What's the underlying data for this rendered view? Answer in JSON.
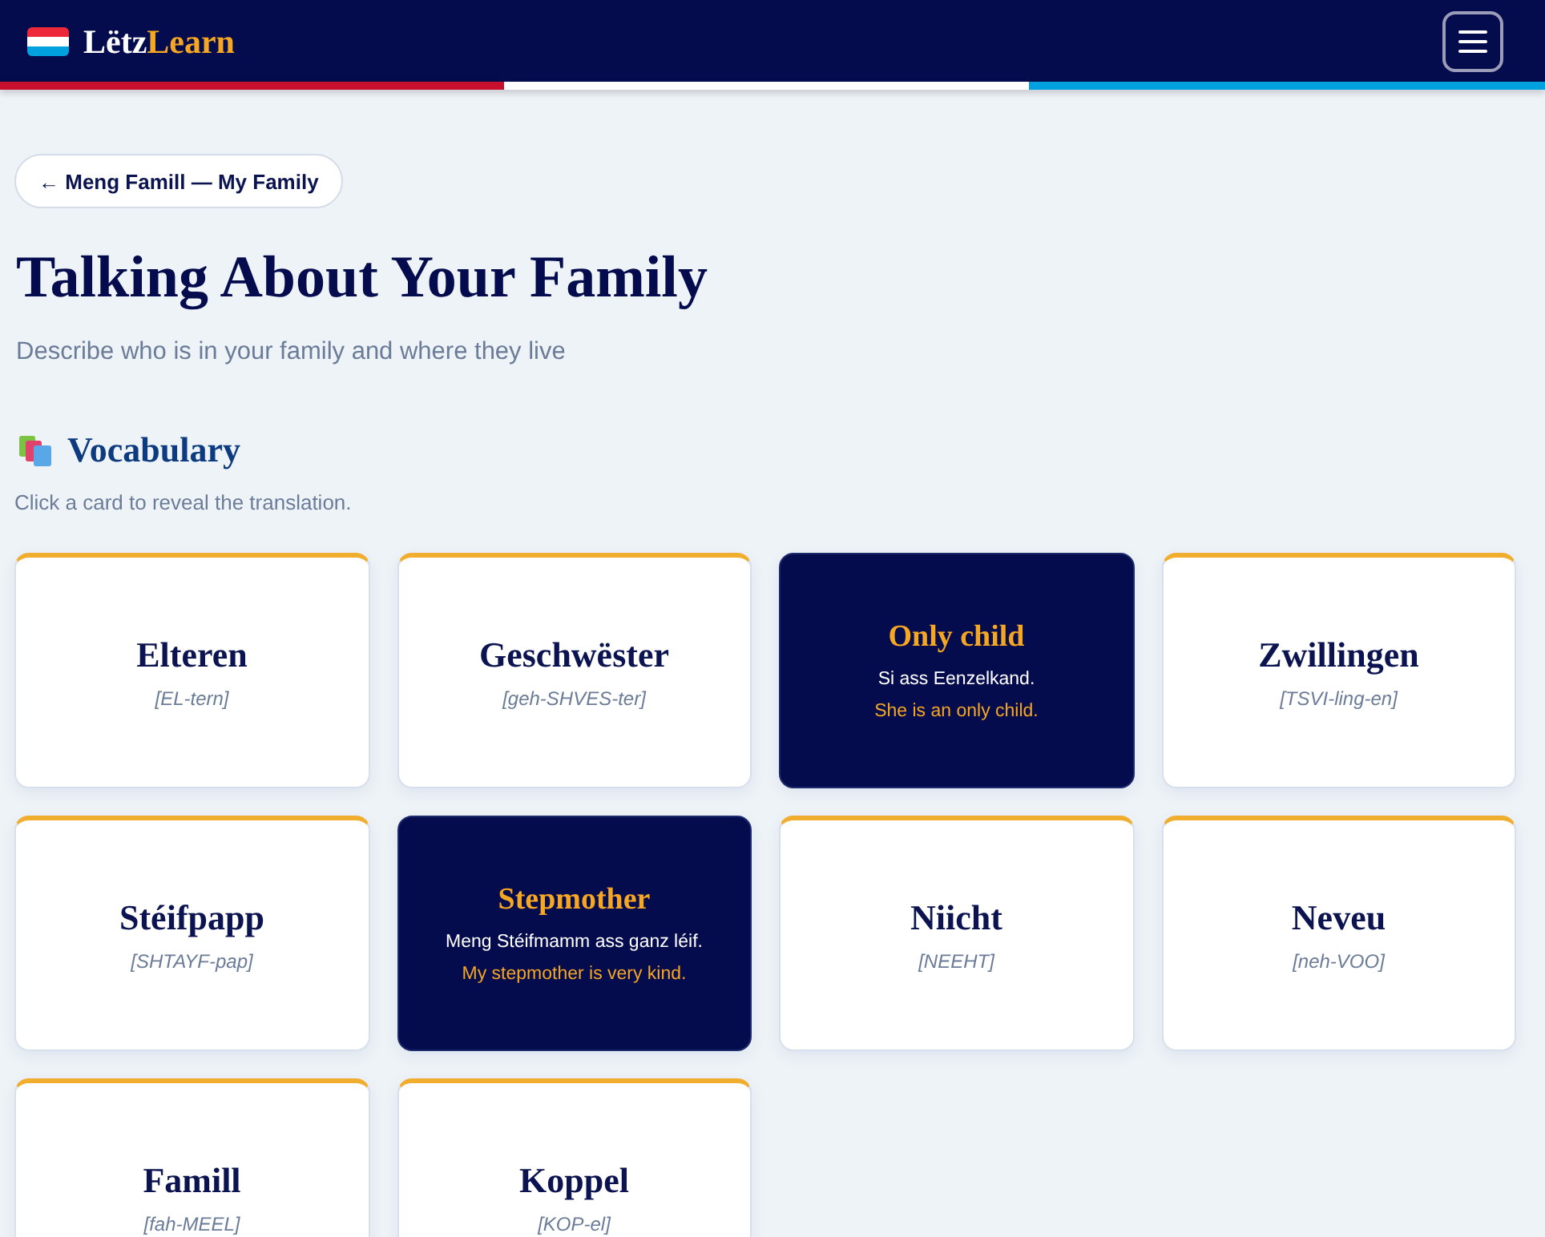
{
  "header": {
    "logo": {
      "prefix": "Lëtz",
      "highlight": "Learn"
    }
  },
  "back_link": {
    "label": "← Meng Famill — My Family"
  },
  "page": {
    "title": "Talking About Your Family",
    "subtitle": "Describe who is in your family and where they live"
  },
  "vocabulary": {
    "heading": "Vocabulary",
    "hint": "Click a card to reveal the translation.",
    "cards": [
      {
        "revealed": false,
        "word": "Elteren",
        "pronunciation": "[EL-tern]"
      },
      {
        "revealed": false,
        "word": "Geschwëster",
        "pronunciation": "[geh-SHVES-ter]"
      },
      {
        "revealed": true,
        "translation": "Only child",
        "example": "Si ass Eenzelkand.",
        "example_translation": "She is an only child."
      },
      {
        "revealed": false,
        "word": "Zwillingen",
        "pronunciation": "[TSVI-ling-en]"
      },
      {
        "revealed": false,
        "word": "Stéifpapp",
        "pronunciation": "[SHTAYF-pap]"
      },
      {
        "revealed": true,
        "translation": "Stepmother",
        "example": "Meng Stéifmamm ass ganz léif.",
        "example_translation": "My stepmother is very kind."
      },
      {
        "revealed": false,
        "word": "Niicht",
        "pronunciation": "[NEEHT]"
      },
      {
        "revealed": false,
        "word": "Neveu",
        "pronunciation": "[neh-VOO]"
      },
      {
        "revealed": false,
        "word": "Famill",
        "pronunciation": "[fah-MEEL]"
      },
      {
        "revealed": false,
        "word": "Koppel",
        "pronunciation": "[KOP-el]"
      }
    ]
  }
}
